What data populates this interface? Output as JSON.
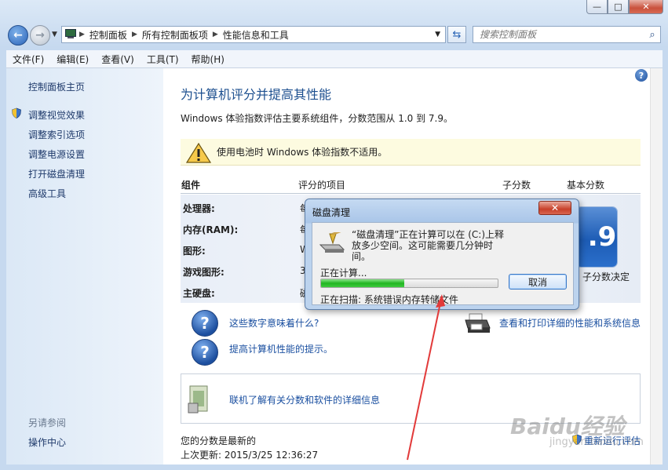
{
  "window": {
    "caption_buttons": {
      "min": "—",
      "max": "□",
      "close": "✕"
    }
  },
  "address": {
    "crumbs": [
      "控制面板",
      "所有控制面板项",
      "性能信息和工具"
    ],
    "search_placeholder": "搜索控制面板"
  },
  "menu": [
    "文件(F)",
    "编辑(E)",
    "查看(V)",
    "工具(T)",
    "帮助(H)"
  ],
  "sidebar": {
    "home": "控制面板主页",
    "items": [
      "调整视觉效果",
      "调整索引选项",
      "调整电源设置",
      "打开磁盘清理",
      "高级工具"
    ],
    "see_also": "另请参阅",
    "see_also_items": [
      "操作中心"
    ]
  },
  "main": {
    "title": "为计算机评分并提高其性能",
    "description": "Windows 体验指数评估主要系统组件，分数范围从 1.0 到 7.9。",
    "warning": "使用电池时 Windows 体验指数不适用。",
    "table": {
      "headers": [
        "组件",
        "评分的项目",
        "子分数",
        "基本分数"
      ],
      "rows": [
        {
          "label": "处理器:",
          "desc": "每"
        },
        {
          "label": "内存(RAM):",
          "desc": "每"
        },
        {
          "label": "图形:",
          "desc": "W"
        },
        {
          "label": "游戏图形:",
          "desc": "3"
        },
        {
          "label": "主硬盘:",
          "desc": "磁"
        }
      ],
      "base_score": ".9",
      "base_caption": "子分数决定"
    },
    "links": {
      "what_numbers": "这些数字意味着什么?",
      "tips": "提高计算机性能的提示。",
      "print_details": "查看和打印详细的性能和系统信息",
      "online_info": "联机了解有关分数和软件的详细信息"
    },
    "footer": {
      "status": "您的分数是最新的",
      "last_update": "上次更新: 2015/3/25 12:36:27",
      "rerun": "重新运行评估"
    }
  },
  "dialog": {
    "title": "磁盘清理",
    "close": "✕",
    "message": "“磁盘清理”正在计算可以在 (C:)上释放多少空间。这可能需要几分钟时间。",
    "calculating": "正在计算...",
    "progress": 0.47,
    "cancel": "取消",
    "scanning": "正在扫描:  系统错误内存转储文件"
  },
  "watermark": {
    "brand": "Baidu经验",
    "url": "jingyan.baidu.com"
  },
  "colors": {
    "link": "#1a4fa0",
    "title": "#1c4f8f",
    "progress": "#21b621",
    "annotation_arrow": "#e23a3a"
  }
}
